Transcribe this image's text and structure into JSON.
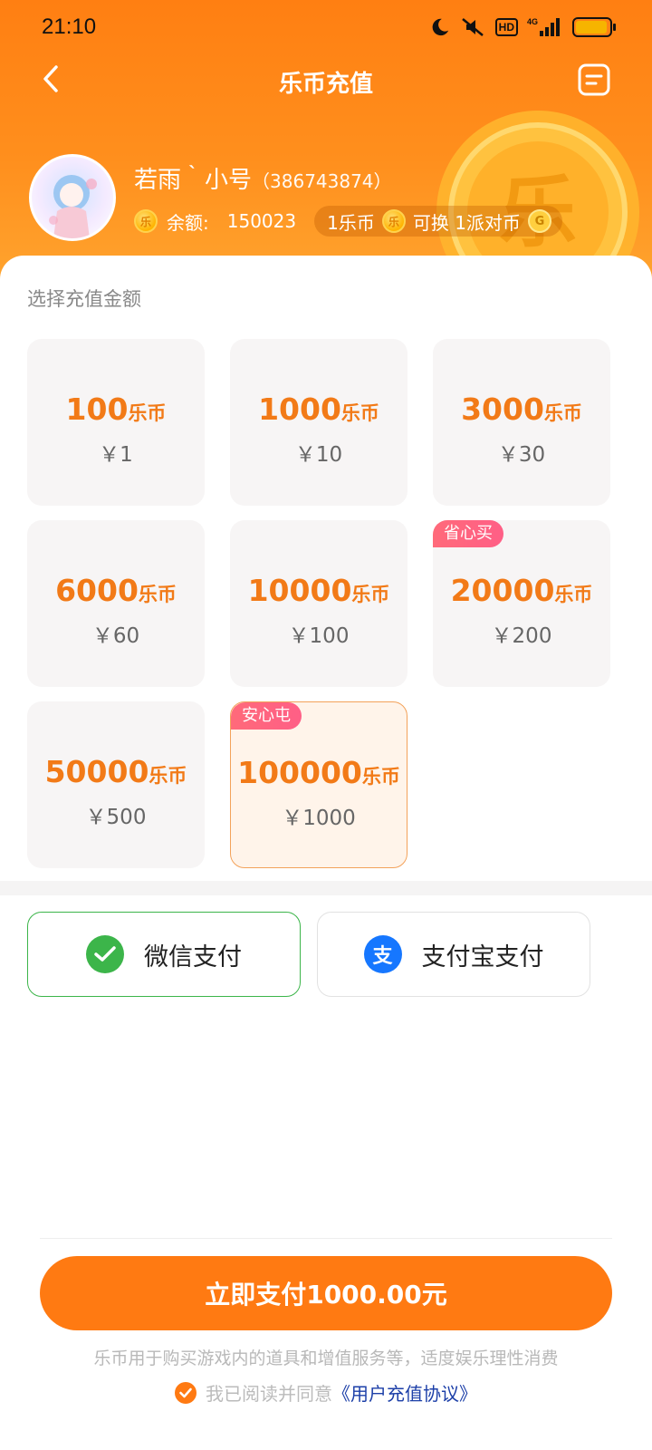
{
  "status_bar": {
    "time": "21:10",
    "hd": "HD",
    "network": "4G",
    "battery_level": 0.95
  },
  "nav": {
    "title": "乐币充值"
  },
  "user": {
    "name": "若雨｀小号",
    "id": "（386743874）",
    "balance_label": "余额:",
    "balance_value": "150023",
    "coin_glyph": "乐",
    "big_coin_glyph": "乐",
    "rate_left": "1乐币",
    "rate_right": "可换 1派对币",
    "party_glyph": "G"
  },
  "section_label": "选择充值金额",
  "packages": [
    {
      "coins": "100",
      "unit": "乐币",
      "price": "￥1",
      "tag": ""
    },
    {
      "coins": "1000",
      "unit": "乐币",
      "price": "￥10",
      "tag": ""
    },
    {
      "coins": "3000",
      "unit": "乐币",
      "price": "￥30",
      "tag": ""
    },
    {
      "coins": "6000",
      "unit": "乐币",
      "price": "￥60",
      "tag": ""
    },
    {
      "coins": "10000",
      "unit": "乐币",
      "price": "￥100",
      "tag": ""
    },
    {
      "coins": "20000",
      "unit": "乐币",
      "price": "￥200",
      "tag": "省心买"
    },
    {
      "coins": "50000",
      "unit": "乐币",
      "price": "￥500",
      "tag": ""
    },
    {
      "coins": "100000",
      "unit": "乐币",
      "price": "￥1000",
      "tag": "安心屯",
      "selected": true
    }
  ],
  "payment": {
    "wechat_label": "微信支付",
    "alipay_label": "支付宝支付",
    "alipay_glyph": "支",
    "selected": "wechat"
  },
  "submit_label": "立即支付1000.00元",
  "disclaimer": "乐币用于购买游戏内的道具和增值服务等，适度娱乐理性消费",
  "agreement": {
    "text": "我已阅读并同意",
    "link": "《用户充值协议》"
  },
  "colors": {
    "accent": "#ff7a12",
    "tag": "#ff6178",
    "wechat": "#3cb54a",
    "alipay": "#1677ff"
  }
}
